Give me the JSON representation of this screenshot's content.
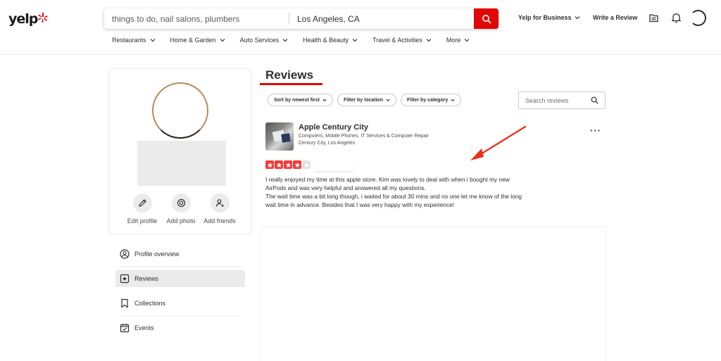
{
  "header": {
    "logo_text": "yelp",
    "search": {
      "find_placeholder": "things to do, nail salons, plumbers",
      "near_value": "Los Angeles, CA"
    },
    "yelp_for_business": "Yelp for Business",
    "write_review": "Write a Review",
    "categories": [
      {
        "label": "Restaurants"
      },
      {
        "label": "Home & Garden"
      },
      {
        "label": "Auto Services"
      },
      {
        "label": "Health & Beauty"
      },
      {
        "label": "Travel & Activities"
      },
      {
        "label": "More"
      }
    ]
  },
  "profile": {
    "actions": [
      {
        "label": "Edit profile",
        "icon": "pencil-icon"
      },
      {
        "label": "Add photo",
        "icon": "camera-icon"
      },
      {
        "label": "Add friends",
        "icon": "add-person-icon"
      }
    ]
  },
  "sidenav": {
    "items": [
      {
        "label": "Profile overview",
        "icon": "person-circle-icon"
      },
      {
        "label": "Reviews",
        "icon": "star-box-icon"
      },
      {
        "label": "Collections",
        "icon": "bookmark-icon"
      },
      {
        "label": "Events",
        "icon": "calendar-check-icon"
      }
    ],
    "active_index": 1
  },
  "main": {
    "title": "Reviews",
    "filters": [
      {
        "label": "Sort by newest first"
      },
      {
        "label": "Filter by location"
      },
      {
        "label": "Filter by category"
      }
    ],
    "search_placeholder": "Search reviews",
    "review": {
      "business_name": "Apple Century City",
      "categories": "Computers, Mobile Phones, IT Services & Computer Repair",
      "location": "Century City, Los Angeles",
      "rating": 4,
      "rating_max": 5,
      "text_lines": [
        "I really enjoyed my time at this apple store. Kim was lovely to deal with when i bought my new",
        "AirPods and was very helpful and answered all my questions.",
        "The wait time was a bit long though, i waited for about 30 mins and no one let me know of the long",
        "wait time in advance. Besides that I was very happy with my experience!"
      ]
    }
  },
  "colors": {
    "brand_red": "#e00707",
    "star_red": "#f43939",
    "annotation_arrow": "#e8321f"
  }
}
